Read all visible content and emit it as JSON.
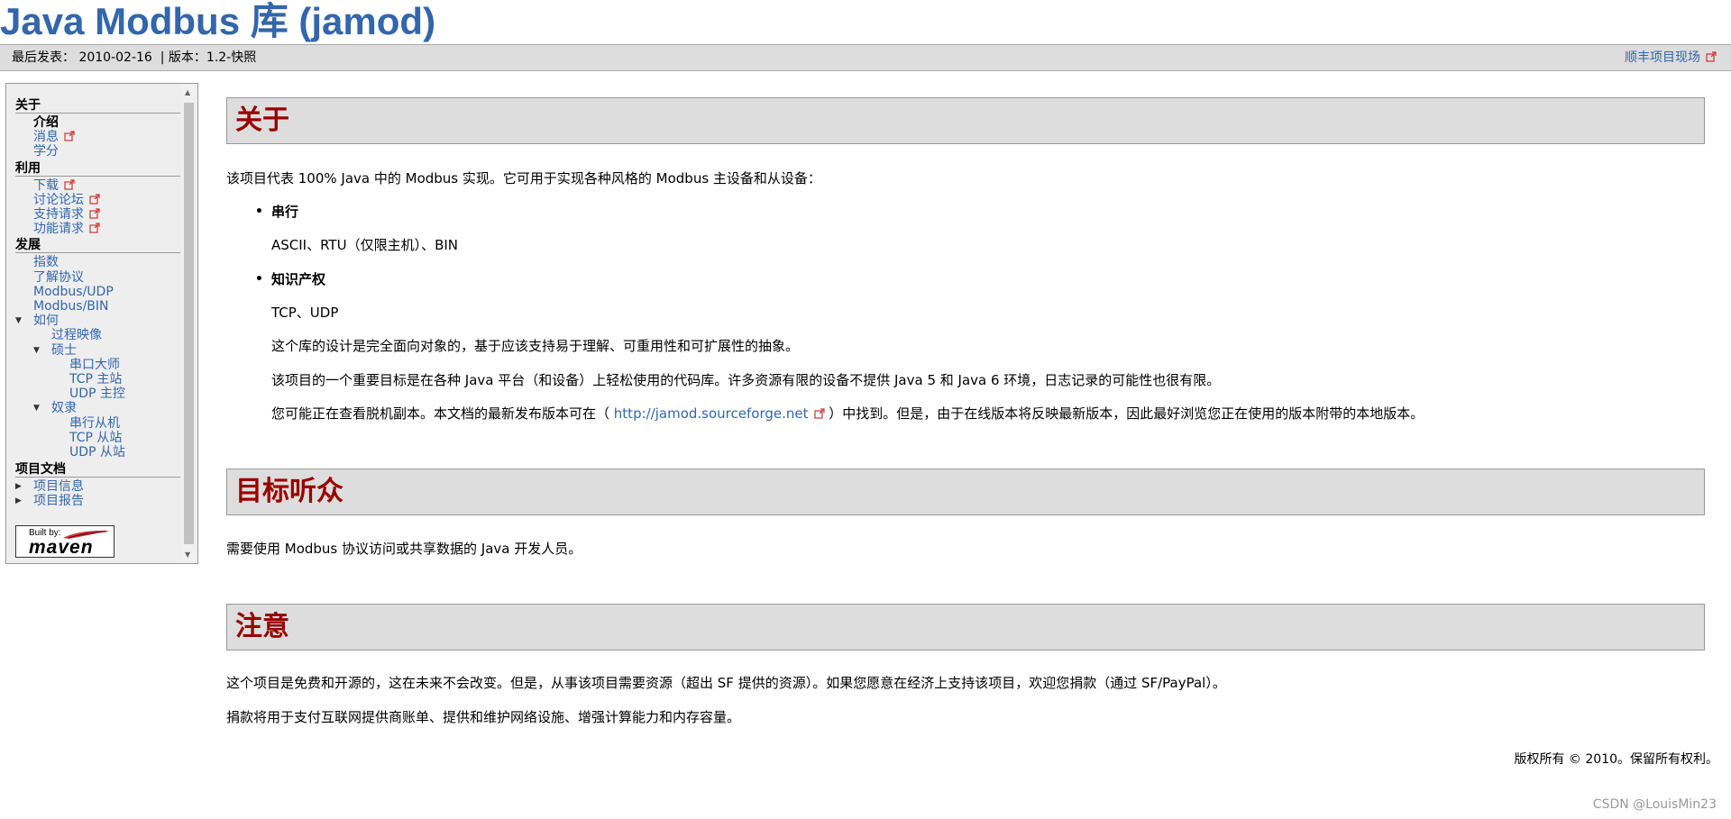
{
  "site": {
    "title": "Java Modbus 库 (jamod)"
  },
  "breadcrumbs": {
    "published_label": "最后发表：",
    "published_date": "2010-02-16",
    "version_label": "| 版本：",
    "version_value": "1.2-快照",
    "project_link": "顺丰项目现场"
  },
  "nav": {
    "about": {
      "heading": "关于",
      "items": [
        "介绍",
        "消息",
        "学分"
      ]
    },
    "use": {
      "heading": "利用",
      "items": [
        "下载",
        "讨论论坛",
        "支持请求",
        "功能请求"
      ]
    },
    "dev": {
      "heading": "发展",
      "items": [
        "指数",
        "了解协议",
        "Modbus/UDP",
        "Modbus/BIN"
      ],
      "howto": "如何",
      "process": "过程映像",
      "master": "硕士",
      "master_items": [
        "串口大师",
        "TCP 主站",
        "UDP 主控"
      ],
      "slave": "奴隶",
      "slave_items": [
        "串行从机",
        "TCP 从站",
        "UDP 从站"
      ]
    },
    "docs": {
      "heading": "项目文档",
      "items": [
        "项目信息",
        "项目报告"
      ]
    },
    "maven": {
      "built_by": "Built by:",
      "word": "maven"
    }
  },
  "main": {
    "about": {
      "title": "关于",
      "intro": "该项目代表 100% Java 中的 Modbus 实现。它可用于实现各种风格的 Modbus 主设备和从设备：",
      "bullet1": "串行",
      "bullet1_desc": "ASCII、RTU（仅限主机）、BIN",
      "bullet2": "知识产权",
      "bullet2_desc": "TCP、UDP",
      "design": "这个库的设计是完全面向对象的，基于应该支持易于理解、可重用性和可扩展性的抽象。",
      "goal": "该项目的一个重要目标是在各种 Java 平台（和设备）上轻松使用的代码库。许多资源有限的设备不提供 Java 5 和 Java 6 环境，日志记录的可能性也很有限。",
      "offline_before": "您可能正在查看脱机副本。本文档的最新发布版本可在（",
      "offline_link": "http://jamod.sourceforge.net",
      "offline_after": "）中找到。但是，由于在线版本将反映最新版本，因此最好浏览您正在使用的版本附带的本地版本。"
    },
    "audience": {
      "title": "目标听众",
      "text": "需要使用 Modbus 协议访问或共享数据的 Java 开发人员。"
    },
    "note": {
      "title": "注意",
      "text1": "这个项目是免费和开源的，这在未来不会改变。但是，从事该项目需要资源（超出 SF 提供的资源）。如果您愿意在经济上支持该项目，欢迎您捐款（通过 SF/PayPal）。",
      "text2": "捐款将用于支付互联网提供商账单、提供和维护网络设施、增强计算能力和内存容量。"
    }
  },
  "footer": {
    "copyright": "版权所有 © 2010。保留所有权利。",
    "watermark": "CSDN @LouisMin23"
  },
  "colors": {
    "link": "#3366aa",
    "section_title": "#990000",
    "box_bg": "#dddddd"
  }
}
